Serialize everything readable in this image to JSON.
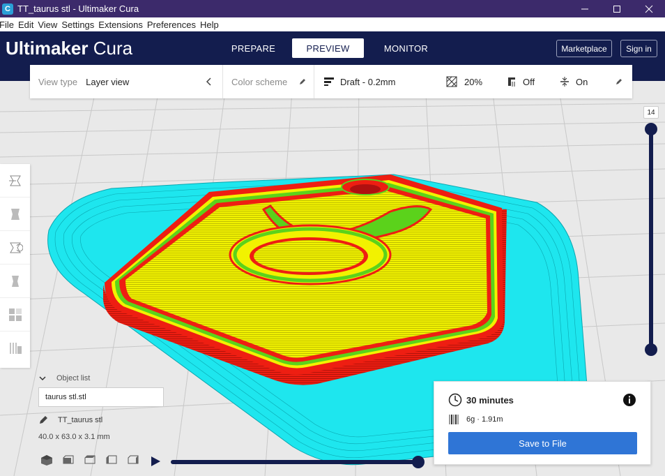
{
  "window": {
    "title": "TT_taurus stl - Ultimaker Cura",
    "app_icon": "C"
  },
  "menu": [
    "File",
    "Edit",
    "View",
    "Settings",
    "Extensions",
    "Preferences",
    "Help"
  ],
  "header": {
    "logo_brand": "Ultimaker",
    "logo_product": "Cura",
    "stages": [
      "PREPARE",
      "PREVIEW",
      "MONITOR"
    ],
    "active_stage": "PREVIEW",
    "marketplace_label": "Marketplace",
    "signin_label": "Sign in"
  },
  "toolbar": {
    "view_type_label": "View type",
    "view_type_value": "Layer view",
    "color_scheme_label": "Color scheme",
    "profile": "Draft - 0.2mm",
    "infill": "20%",
    "support": "Off",
    "adhesion": "On"
  },
  "layer_slider": {
    "current_layer": "14",
    "level": 1.0
  },
  "object_list": {
    "header": "Object list",
    "selected_file": "taurus stl.stl",
    "object_name": "TT_taurus stl",
    "dimensions": "40.0 x 63.0 x 3.1 mm"
  },
  "simulation": {
    "progress": 1.0
  },
  "print_info": {
    "time": "30 minutes",
    "material": "6g · 1.91m",
    "save_label": "Save to File"
  },
  "colors": {
    "header_bg": "#131d4e",
    "titlebar_bg": "#3c2a6b",
    "accent": "#2f75d6",
    "skirt": "#1ee6ee",
    "wall": "#ee1e12",
    "top_skin": "#f5f500",
    "inner_wall": "#5bd21b"
  }
}
